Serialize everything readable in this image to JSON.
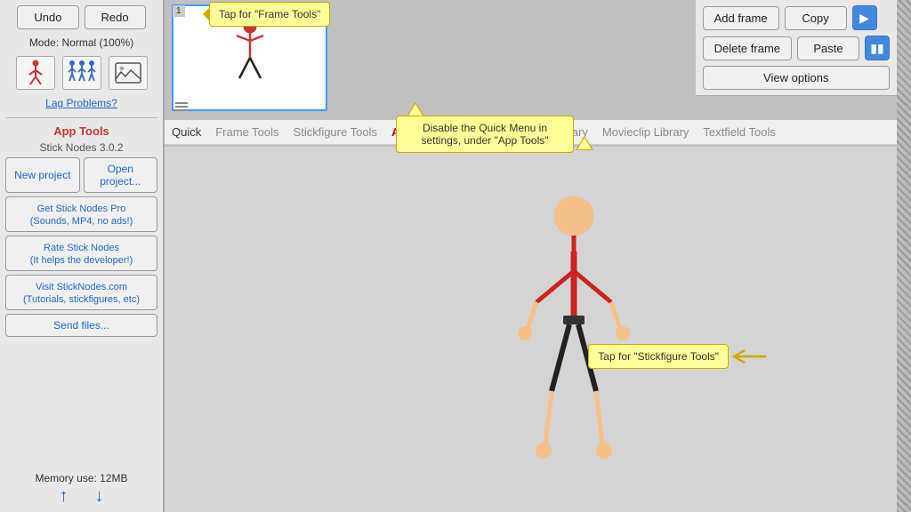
{
  "sidebar": {
    "undo_label": "Undo",
    "redo_label": "Redo",
    "mode_label": "Mode: Normal (100%)",
    "lag_label": "Lag Problems?",
    "app_tools_title": "App Tools",
    "app_tools_subtitle": "Stick Nodes 3.0.2",
    "new_project_label": "New project",
    "open_project_label": "Open project...",
    "pro_label": "Get Stick Nodes Pro\n(Sounds, MP4, no ads!)",
    "rate_label": "Rate Stick Nodes\n(It helps the developer!)",
    "visit_label": "Visit StickNodes.com\n(Tutorials, stickfigures, etc)",
    "send_files_label": "Send files...",
    "memory_label": "Memory use: 12MB",
    "arrow_up": "↑",
    "arrow_down": "↓"
  },
  "toolbar": {
    "add_frame_label": "Add frame",
    "copy_label": "Copy",
    "delete_frame_label": "Delete frame",
    "paste_label": "Paste",
    "view_options_label": "View options"
  },
  "nav_tabs": {
    "quick_label": "Quick",
    "frame_tools_label": "Frame Tools",
    "stickfigure_tools_label": "Stickfigure Tools",
    "animation_tools_label": "Animation Tools",
    "stickfigure_library_label": "Stickfigure Library",
    "movieclip_library_label": "Movieclip Library",
    "textfield_tools_label": "Textfield Tools"
  },
  "tooltips": {
    "frame_tools": "Tap for \"Frame Tools\"",
    "quick_menu": "Disable the Quick Menu in settings, under \"App Tools\"",
    "stickfigure_tools": "Tap for \"Stickfigure Tools\""
  },
  "icons": {
    "stick_person": "🏃",
    "stick_group": "👥",
    "image_icon": "🖼"
  }
}
